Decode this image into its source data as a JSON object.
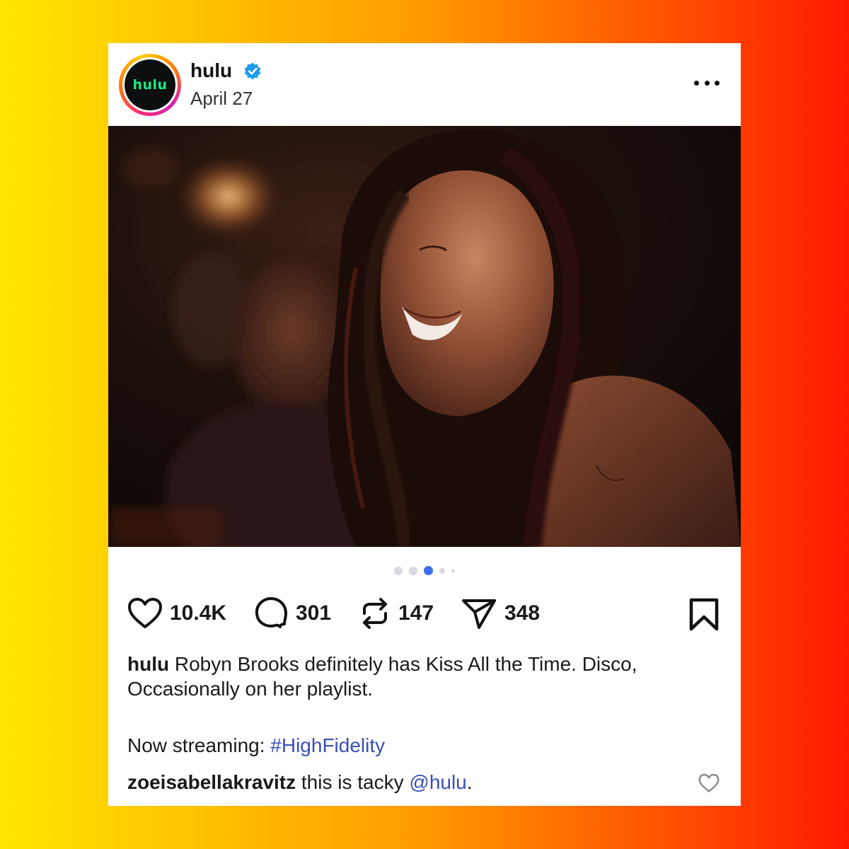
{
  "colors": {
    "background_left": "#ffe600",
    "background_right": "#ff1a00",
    "accent_blue": "#3f6df0",
    "link_color": "#3b4fb8",
    "hulu_green": "#1ce783"
  },
  "header": {
    "avatar_text": "hulu",
    "username": "hulu",
    "verified_icon": "verified-badge-icon",
    "date": "April 27",
    "more_icon": "more-options-icon"
  },
  "media": {
    "carousel_total": 5,
    "carousel_active": 3
  },
  "actions": {
    "likes": "10.4K",
    "comments": "301",
    "reposts": "147",
    "shares": "348",
    "icons": [
      "heart-icon",
      "comment-icon",
      "repost-icon",
      "share-icon",
      "bookmark-icon"
    ]
  },
  "caption": {
    "username": "hulu",
    "text": "Robyn Brooks definitely has Kiss All the Time. Disco, Occasionally on her playlist.",
    "streaming_prefix": "Now streaming: ",
    "hashtag": "#HighFidelity"
  },
  "comment": {
    "username": "zoeisabellakravitz",
    "text": "this is tacky ",
    "mention": "@hulu",
    "suffix": "."
  }
}
